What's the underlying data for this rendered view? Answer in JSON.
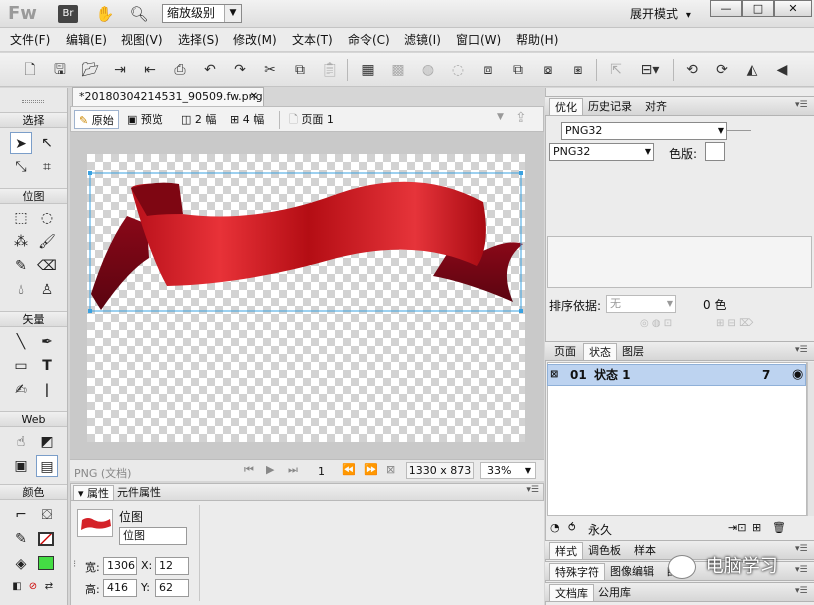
{
  "titlebar": {
    "logo": "Fw",
    "bridge_label": "Br",
    "zoom_select": "缩放级别",
    "mode": "展开模式",
    "mode_arrow": "▾",
    "min": "—",
    "max": "□",
    "close": "✕"
  },
  "menu": [
    "文件(F)",
    "编辑(E)",
    "视图(V)",
    "选择(S)",
    "修改(M)",
    "文本(T)",
    "命令(C)",
    "滤镜(I)",
    "窗口(W)",
    "帮助(H)"
  ],
  "tools": {
    "sections": [
      "选择",
      "位图",
      "矢量",
      "Web",
      "颜色"
    ],
    "stroke_color": "#cc0000",
    "fill_color": "#44dd44"
  },
  "document": {
    "tab_title": "*20180304214531_90509.fw.png",
    "tab_close": "✕",
    "views": [
      "原始",
      "预览",
      "2 幅",
      "4 幅"
    ],
    "page_label": "页面 1",
    "status_left": "PNG (文档)",
    "frame_number": "1",
    "dimensions": "1330 x 873",
    "zoom": "33%"
  },
  "properties": {
    "tabs": [
      "属性",
      "元件属性"
    ],
    "object_type": "位图",
    "object_name": "位图",
    "width_label": "宽:",
    "width": "1306",
    "height_label": "高:",
    "height": "416",
    "x_label": "X:",
    "x": "12",
    "y_label": "Y:",
    "y": "62"
  },
  "optimize": {
    "tabs": [
      "优化",
      "历史记录",
      "对齐"
    ],
    "preset": "PNG32",
    "format": "PNG32",
    "palette_label": "色版:",
    "sort_label": "排序依据:",
    "sort_value": "无",
    "color_count": "0 色"
  },
  "pages_panel": {
    "tabs": [
      "页面",
      "状态",
      "图层"
    ],
    "state_number": "01",
    "state_name": "状态 1",
    "state_delay": "7",
    "footer_label": "永久"
  },
  "bottom_panels": {
    "row1": [
      "样式",
      "调色板",
      "样本"
    ],
    "row2": [
      "特殊字符",
      "图像编辑",
      "自"
    ],
    "row3": [
      "文档库",
      "公用库"
    ]
  },
  "watermark": "电脑学习"
}
